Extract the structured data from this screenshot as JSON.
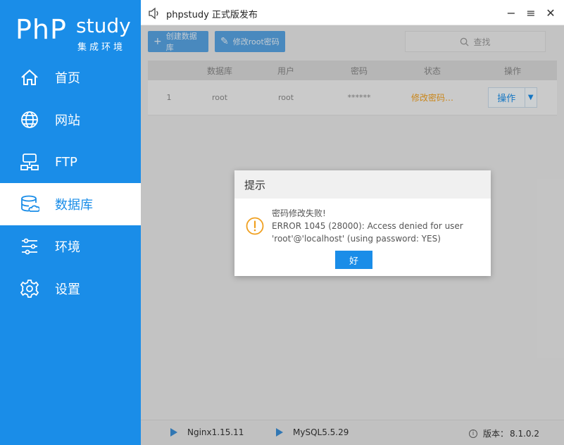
{
  "app": {
    "logo_main": "PhP",
    "logo_study": "study",
    "logo_sub": "集成环境",
    "window_title": "phpstudy 正式版发布",
    "brand_color": "#1a8de8"
  },
  "sidebar": {
    "items": [
      {
        "label": "首页",
        "icon": "home-icon"
      },
      {
        "label": "网站",
        "icon": "globe-icon"
      },
      {
        "label": "FTP",
        "icon": "ftp-icon"
      },
      {
        "label": "数据库",
        "icon": "database-icon",
        "active": true
      },
      {
        "label": "环境",
        "icon": "sliders-icon"
      },
      {
        "label": "设置",
        "icon": "gear-icon"
      }
    ]
  },
  "titlebar": {
    "minimize": "−",
    "menu": "≡",
    "close": "✕"
  },
  "toolbar": {
    "create_db": "创建数据库",
    "change_root_pw": "修改root密码",
    "search_placeholder": "查找"
  },
  "table": {
    "headers": [
      "数据库",
      "用户",
      "密码",
      "状态",
      "操作"
    ],
    "rows": [
      {
        "index": "1",
        "database": "root",
        "user": "root",
        "password": "******",
        "status": "修改密码…",
        "action": "操作"
      }
    ]
  },
  "statusbar": {
    "nginx": "Nginx1.15.11",
    "mysql": "MySQL5.5.29",
    "version_label": "版本：",
    "version": "8.1.0.2"
  },
  "dialog": {
    "title": "提示",
    "line1": "密码修改失败!",
    "line2": "ERROR 1045 (28000): Access denied for user",
    "line3": "'root'@'localhost' (using password: YES)",
    "ok": "好",
    "warning_color": "#f0a020"
  }
}
